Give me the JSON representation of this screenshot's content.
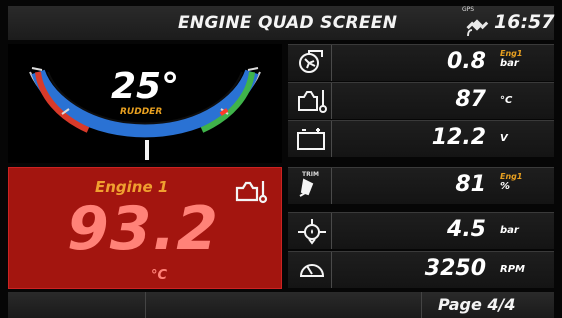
{
  "header": {
    "title": "ENGINE QUAD SCREEN",
    "gps_label": "GPS",
    "gps_icon": "satellite-icon",
    "time": "16:57"
  },
  "rudder": {
    "value": "25°",
    "label": "RUDDER",
    "icon": "rudder-gauge"
  },
  "alarm": {
    "title": "Engine 1",
    "value": "93.2",
    "unit": "°C",
    "icon": "oil-temperature-icon",
    "background_color": "#a3150f"
  },
  "rows": [
    {
      "icon": "turbo-boost-icon",
      "value": "0.8",
      "engine": "Eng1",
      "unit": "bar"
    },
    {
      "icon": "oil-temperature-icon",
      "value": "87",
      "unit": "°C"
    },
    {
      "icon": "battery-icon",
      "value": "12.2",
      "unit": "V"
    },
    {
      "icon": "trim-icon",
      "icon_label": "TRIM",
      "value": "81",
      "engine": "Eng1",
      "unit": "%"
    },
    {
      "icon": "oil-pressure-icon",
      "value": "4.5",
      "unit": "bar"
    },
    {
      "icon": "tachometer-icon",
      "value": "3250",
      "unit": "RPM"
    }
  ],
  "footer": {
    "page": "Page 4/4"
  }
}
